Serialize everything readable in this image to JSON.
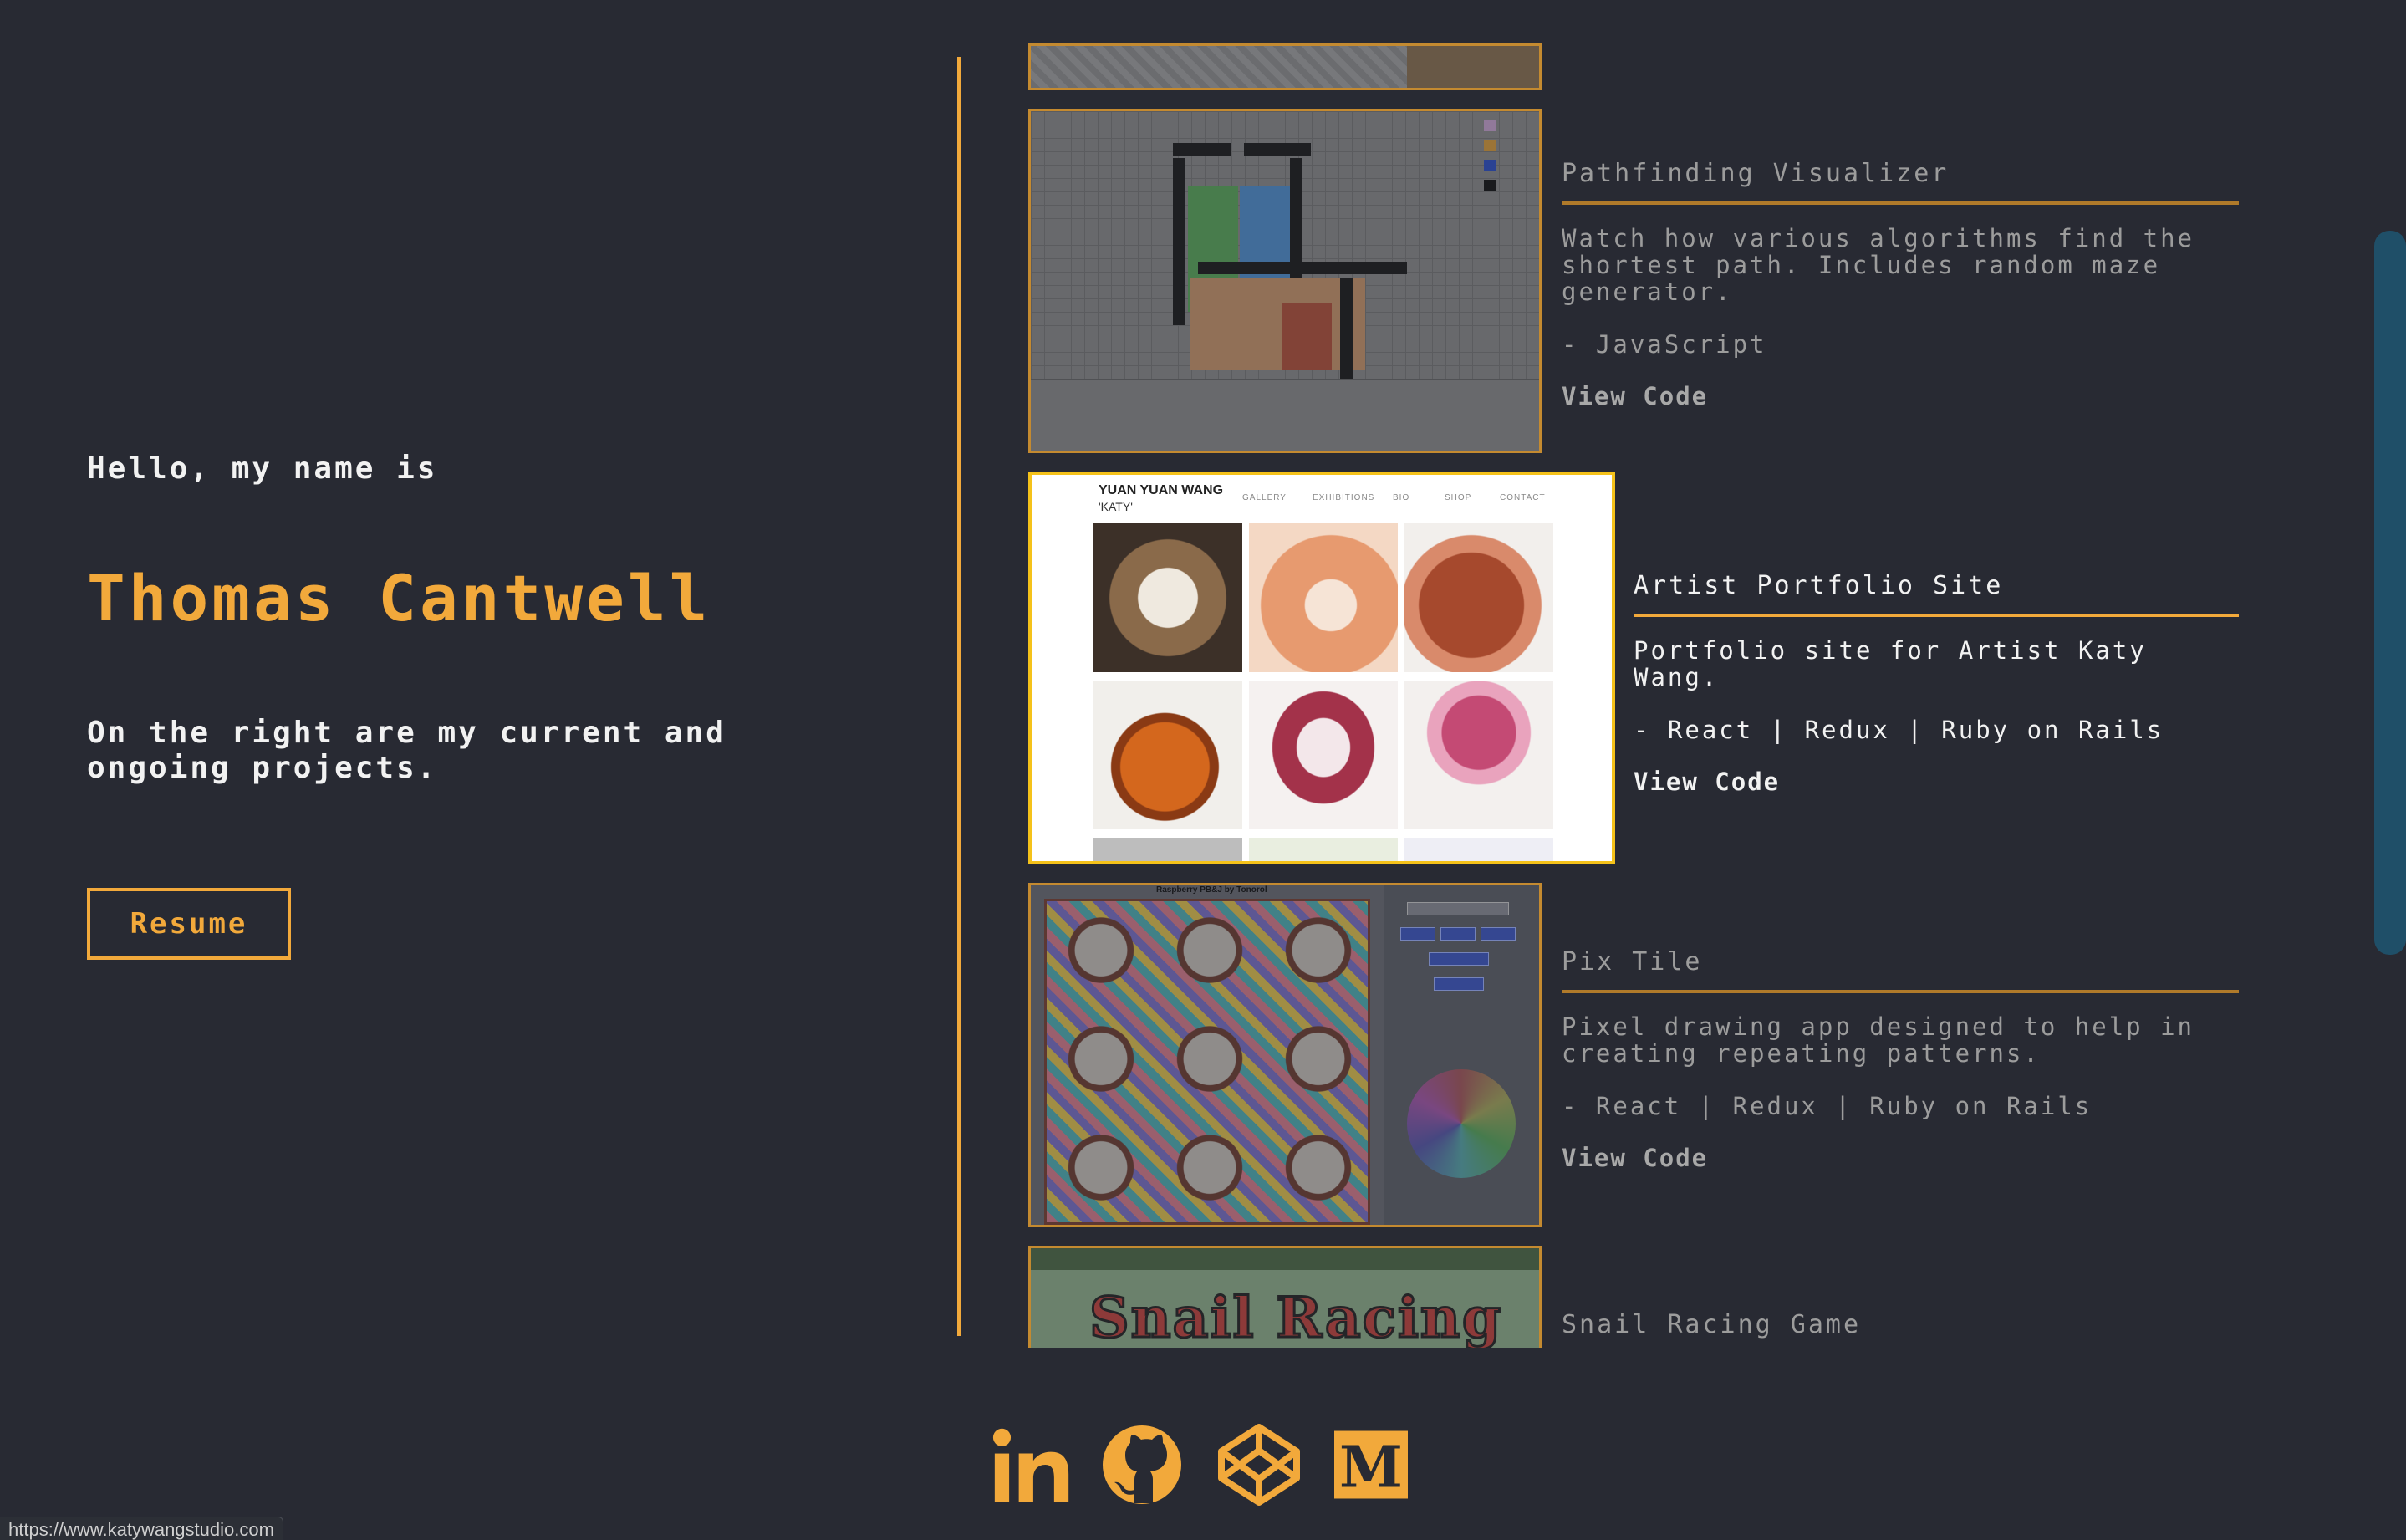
{
  "intro": {
    "greeting": "Hello, my name is",
    "name": "Thomas Cantwell",
    "tagline": "On the right are my current and ongoing projects.",
    "resume_label": "Resume"
  },
  "projects": [
    {
      "title": "Pathfinding Visualizer",
      "description": "Watch how various algorithms find the shortest path. Includes random maze generator.",
      "tech": "- JavaScript",
      "link_label": "View Code"
    },
    {
      "title": "Artist Portfolio Site",
      "description": "Portfolio site for Artist Katy Wang.",
      "tech": "- React | Redux | Ruby on Rails",
      "link_label": "View Code",
      "thumb": {
        "header": "YUAN YUAN WANG",
        "sub": "'KATY'",
        "nav": [
          "GALLERY",
          "EXHIBITIONS",
          "BIO",
          "SHOP",
          "CONTACT"
        ]
      }
    },
    {
      "title": "Pix Tile",
      "description": "Pixel drawing app designed to help in creating repeating patterns.",
      "tech": "- React | Redux | Ruby on Rails",
      "link_label": "View Code",
      "thumb": {
        "header": "Raspberry PB&J by Tonorol"
      }
    },
    {
      "title": "Snail Racing Game",
      "thumb": {
        "logo": "Snail Racing"
      }
    }
  ],
  "social": {
    "icons": [
      "linkedin-icon",
      "github-icon",
      "codepen-icon",
      "medium-icon"
    ],
    "color": "#f2a93b"
  },
  "status_url": "https://www.katywangstudio.com",
  "colors": {
    "background": "#282a33",
    "accent": "#f2a93b",
    "active_border": "#f5c21a",
    "scrollbar": "#1f4f68"
  }
}
